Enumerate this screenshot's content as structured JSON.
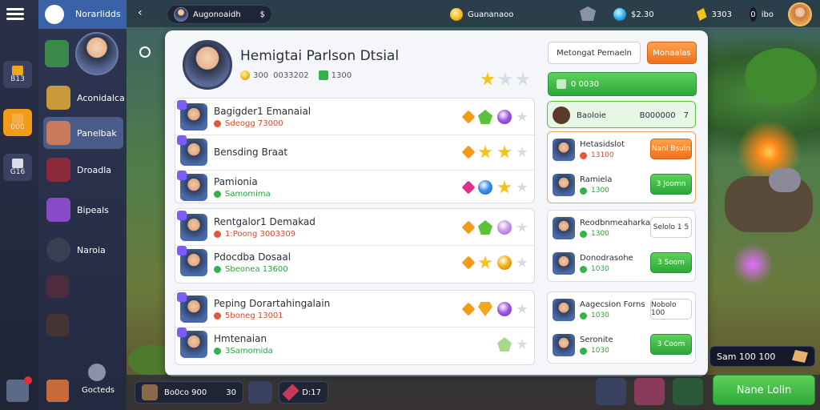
{
  "left_rail": {
    "tiles": [
      {
        "label": "B13"
      },
      {
        "label": "000"
      },
      {
        "label": "G16"
      }
    ]
  },
  "sidebar": {
    "title": "Norarlidds",
    "items": [
      {
        "label": "Aconidalca"
      },
      {
        "label": "Panelbak"
      },
      {
        "label": "Droadla"
      },
      {
        "label": "Bipeals"
      },
      {
        "label": "Naroia"
      }
    ],
    "bottom_label": "Gocteds"
  },
  "topbar": {
    "player_name": "Augonoaidh",
    "currency_label": "Guananaoo",
    "gem_value": "$2.30",
    "ticket_value": "3303",
    "count_value": "0",
    "count_extra": "ibo"
  },
  "profile": {
    "name": "Hemigtai Parlson Dtsial",
    "coin_value": "300",
    "coin_suffix": "0033202",
    "cash_value": "1300"
  },
  "list_groups": [
    {
      "rows": [
        {
          "name": "Bagigder1 Emanaial",
          "sub": "Sdeogg 73000",
          "sub_color": "red",
          "icons": [
            "orange",
            "green-gem",
            "orb-purple",
            "star-out"
          ]
        },
        {
          "name": "Bensding Braat",
          "sub": "",
          "sub_color": "none",
          "icons": [
            "orange",
            "gold-star",
            "gold-star",
            "star-out"
          ]
        },
        {
          "name": "Pamionia",
          "sub": "Samomima",
          "sub_color": "green",
          "icons": [
            "pink",
            "orb-blue",
            "gold-star",
            "star-out"
          ]
        }
      ]
    },
    {
      "rows": [
        {
          "name": "Rentgalor1 Demakad",
          "sub": "1:Poong 3003309",
          "sub_color": "red",
          "icons": [
            "orange",
            "green-gem",
            "orb-lav",
            "star-out"
          ]
        },
        {
          "name": "Pdocdba Dosaal",
          "sub": "Sbeonea 13600",
          "sub_color": "green",
          "icons": [
            "orange",
            "gold-star",
            "orb-gold",
            "star-out"
          ]
        }
      ]
    },
    {
      "rows": [
        {
          "name": "Peping Dorartahingalain",
          "sub": "5boneg 13001",
          "sub_color": "red",
          "icons": [
            "orange",
            "gold-diamond",
            "orb-purple",
            "star-out"
          ]
        },
        {
          "name": "Hmtenaian",
          "sub": "3Samomida",
          "sub_color": "green",
          "icons": [
            "pale-gem",
            "star-out"
          ]
        }
      ]
    }
  ],
  "right_panel": {
    "top_white_button": "Metongat Pemaeln",
    "top_orange_button": "Monaalas",
    "green_bar_value": "0 0030",
    "header_card": {
      "label": "Baoloie",
      "value": "B000000",
      "suffix": "7"
    },
    "groups": [
      {
        "rows": [
          {
            "name": "Hetasidslot",
            "sub": "13100",
            "sub_color": "red",
            "button": "Nanl Bsuln",
            "button_type": "orange"
          },
          {
            "name": "Ramiela",
            "sub": "1300",
            "sub_color": "green",
            "button": "3 Joomn",
            "button_type": "green"
          }
        ]
      },
      {
        "rows": [
          {
            "name": "Reodbnmeaharka",
            "sub": "1300",
            "sub_color": "green",
            "button": "Selolo 1 5",
            "button_type": "white"
          },
          {
            "name": "Donodrasohe",
            "sub": "1030",
            "sub_color": "green",
            "button": "3 Soom",
            "button_type": "green"
          }
        ]
      },
      {
        "rows": [
          {
            "name": "Aagecsion Forns",
            "sub": "1030",
            "sub_color": "green",
            "button": "Nobolo 100",
            "button_type": "white"
          },
          {
            "name": "Seronite",
            "sub": "1030",
            "sub_color": "green",
            "button": "3 Coom",
            "button_type": "green"
          }
        ]
      }
    ]
  },
  "bottombar": {
    "slot1_text": "Bo0co  900",
    "slot1_extra": "30",
    "slot2_text": "D:17",
    "resource_text": "Sam  100  100",
    "main_button": "Nane Lolin"
  },
  "colors": {
    "accent_orange": "#f0701a",
    "accent_green": "#2ea83a",
    "panel_bg": "#f4f6fa",
    "sidebar_active": "#4a5d8a"
  }
}
